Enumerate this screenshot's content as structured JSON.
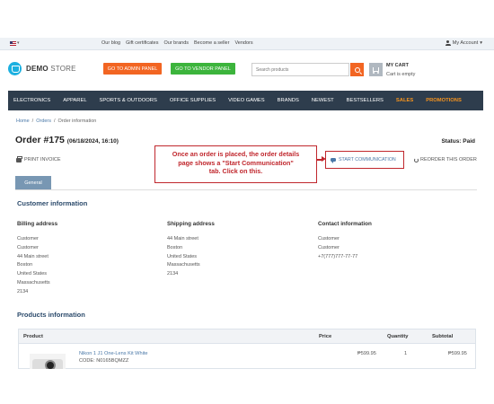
{
  "topbar": {
    "language_caret": "▾",
    "links": [
      "Our blog",
      "Gift certificates",
      "Our brands",
      "Become a seller",
      "Vendors"
    ],
    "account_label": "My Account",
    "account_caret": "▾"
  },
  "header": {
    "logo_bold": "DEMO",
    "logo_light": "STORE",
    "admin_button": "GO TO ADMIN PANEL",
    "vendor_button": "GO TO VENDOR PANEL",
    "search_placeholder": "Search products",
    "cart_title": "MY CART",
    "cart_status": "Cart is empty"
  },
  "nav": {
    "items": [
      "ELECTRONICS",
      "APPAREL",
      "SPORTS & OUTDOORS",
      "OFFICE SUPPLIES",
      "VIDEO GAMES",
      "BRANDS",
      "NEWEST",
      "BESTSELLERS"
    ],
    "sales": "SALES",
    "promotions": "PROMOTIONS"
  },
  "breadcrumb": {
    "home": "Home",
    "orders": "Orders",
    "current": "Order information",
    "separator": "/"
  },
  "order": {
    "title": "Order #175",
    "date": "(06/18/2024, 16:10)",
    "status": "Status: Paid",
    "print_invoice": "PRINT INVOICE",
    "start_communication": "START COMMUNICATION",
    "reorder": "REORDER THIS ORDER"
  },
  "callout": {
    "line1": "Once an order is placed, the order details",
    "line2": "page shows a \"Start Communication\"",
    "line3": "tab. Click on this."
  },
  "tabs": {
    "general": "General"
  },
  "customer": {
    "section_title": "Customer information",
    "billing": {
      "title": "Billing address",
      "lines": [
        "Customer",
        "Customer",
        "44 Main street",
        "Boston",
        "United States",
        "Massachusetts",
        "2134"
      ]
    },
    "shipping": {
      "title": "Shipping address",
      "lines": [
        "44 Main street",
        "Boston",
        "United States",
        "Massachusetts",
        "2134"
      ]
    },
    "contact": {
      "title": "Contact information",
      "lines": [
        "Customer",
        "Customer",
        "+7(777)777-77-77"
      ]
    }
  },
  "products": {
    "section_title": "Products information",
    "columns": {
      "product": "Product",
      "price": "Price",
      "quantity": "Quantity",
      "subtotal": "Subtotal"
    },
    "rows": [
      {
        "name": "Nikon 1 J1 One-Lens Kit White",
        "code": "CODE: N0165BQMZZ",
        "price": "₱599.95",
        "quantity": "1",
        "subtotal": "₱599.95"
      }
    ]
  },
  "colors": {
    "accent_orange": "#f26522",
    "vendor_green": "#3cb43c",
    "nav_background": "#2e3d4d",
    "callout_red": "#c0272d",
    "link_blue": "#4a78a8"
  }
}
